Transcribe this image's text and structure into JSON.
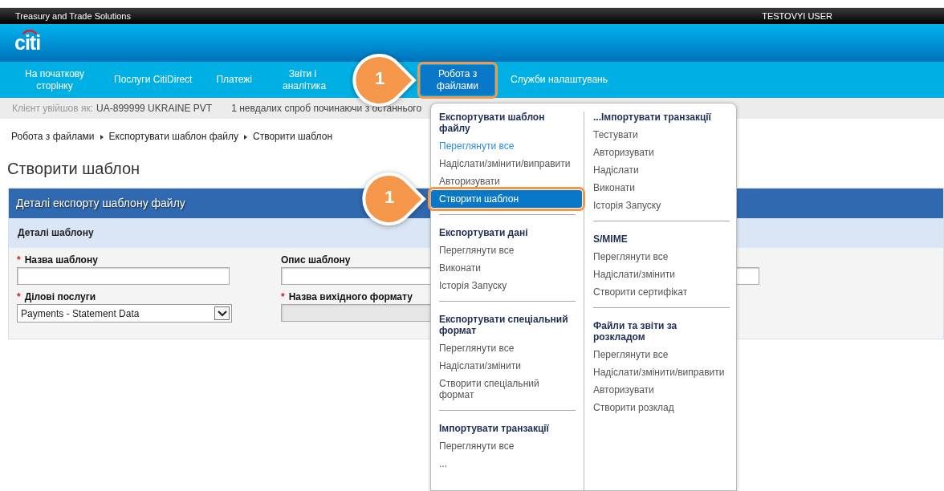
{
  "top_bar": {
    "brand": "Treasury and Trade Solutions",
    "user": "TESTOVYI USER"
  },
  "logo": "citi",
  "nav": [
    {
      "label": "На початкову сторінку",
      "selected": false
    },
    {
      "label": "Послуги CitiDirect",
      "selected": false
    },
    {
      "label": "Платежі",
      "selected": false
    },
    {
      "label": "Звіти і аналітика",
      "selected": false
    },
    {
      "label": "Робота з файлами",
      "selected": true,
      "callout": "1"
    },
    {
      "label": "Служби налаштувань",
      "selected": false
    }
  ],
  "info_bar": {
    "label": "Клієнт увійшов як:",
    "value": "UA-899999 UKRAINE PVT",
    "message": "1 невдалих спроб починаючи з останнього"
  },
  "breadcrumb": [
    "Робота з файлами",
    "Експортувати шаблон файлу",
    "Створити шаблон"
  ],
  "page_title": "Створити шаблон",
  "panel": {
    "title": "Деталі експорту шаблону файлу",
    "section": "Деталі шаблону",
    "fields": [
      {
        "label": "Назва шаблону",
        "required_mark": "*",
        "kind": "text"
      },
      {
        "label": "Опис шаблону",
        "kind": "wide"
      },
      {
        "label": "Ділові послуги",
        "required_mark": "*",
        "kind": "select",
        "value": "Payments - Statement Data"
      },
      {
        "label": "Назва вихідного формату",
        "required_mark": "*",
        "kind": "text",
        "disabled": true
      }
    ]
  },
  "menu": {
    "columns": [
      [
        {
          "title": "Експортувати шаблон файлу",
          "items": [
            {
              "label": "Переглянути все",
              "kind": "link",
              "selected": false
            },
            {
              "label": "Надіслати/змінити/виправити",
              "kind": "item",
              "selected": false
            },
            {
              "label": "Авторизувати",
              "kind": "item",
              "selected": false
            },
            {
              "label": "Створити шаблон",
              "kind": "item",
              "selected": true,
              "callout": "1"
            }
          ]
        },
        {
          "title": "Експортувати дані",
          "items": [
            {
              "label": "Переглянути все",
              "kind": "item",
              "selected": false
            },
            {
              "label": "Виконати",
              "kind": "item",
              "selected": false
            },
            {
              "label": "Історія Запуску",
              "kind": "item",
              "selected": false
            }
          ]
        },
        {
          "title": "Експортувати спеціальний формат",
          "items": [
            {
              "label": "Переглянути все",
              "kind": "item",
              "selected": false
            },
            {
              "label": "Надіслати/змінити",
              "kind": "item",
              "selected": false
            },
            {
              "label": "Створити спеціальний формат",
              "kind": "item",
              "selected": false
            }
          ]
        },
        {
          "title": "Імпортувати транзакції",
          "items": [
            {
              "label": "Переглянути все",
              "kind": "item",
              "selected": false
            },
            {
              "label": "...",
              "kind": "item",
              "selected": false
            }
          ]
        }
      ],
      [
        {
          "title": "...Імпортувати транзакції",
          "items": [
            {
              "label": "Тестувати",
              "kind": "item",
              "selected": false
            },
            {
              "label": "Авторизувати",
              "kind": "item",
              "selected": false
            },
            {
              "label": "Надіслати",
              "kind": "item",
              "selected": false
            },
            {
              "label": "Виконати",
              "kind": "item",
              "selected": false
            },
            {
              "label": "Історія Запуску",
              "kind": "item",
              "selected": false
            }
          ]
        },
        {
          "title": "S/MIME",
          "items": [
            {
              "label": "Переглянути все",
              "kind": "item",
              "selected": false
            },
            {
              "label": "Надіслати/змінити",
              "kind": "item",
              "selected": false
            },
            {
              "label": "Створити сертифікат",
              "kind": "item",
              "selected": false
            }
          ]
        },
        {
          "title": "Файли та звіти за розкладом",
          "items": [
            {
              "label": "Переглянути все",
              "kind": "item",
              "selected": false
            },
            {
              "label": "Надіслати/змінити/виправити",
              "kind": "item",
              "selected": false
            },
            {
              "label": "Авторизувати",
              "kind": "item",
              "selected": false
            },
            {
              "label": "Створити розклад",
              "kind": "item",
              "selected": false
            }
          ]
        }
      ]
    ]
  }
}
